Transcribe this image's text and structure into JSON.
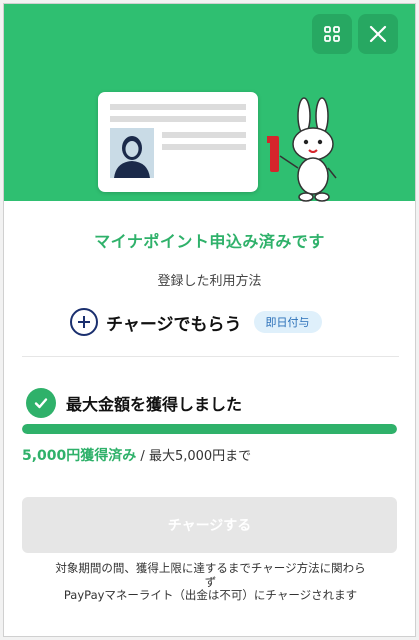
{
  "header": {
    "grid_icon": "grid-icon",
    "close_icon": "close-icon"
  },
  "status": {
    "headline": "マイナポイント申込み済みです",
    "subhead": "登録した利用方法"
  },
  "method": {
    "label": "チャージでもらう",
    "badge": "即日付与",
    "icon": "plus-circle-icon"
  },
  "achievement": {
    "label": "最大金額を獲得しました",
    "icon": "check-circle-icon",
    "progress": 1.0,
    "earned": "5,000円獲得済み",
    "separator": " / ",
    "max": "最大5,000円まで"
  },
  "charge_button": {
    "label": "チャージする"
  },
  "note": {
    "line1": "対象期間の間、獲得上限に達するまでチャージ方法に関わら",
    "line2": "ず",
    "line3": "PayPayマネーライト（出金は不可）にチャージされます"
  },
  "colors": {
    "brand_green": "#2fbf71",
    "accent_green": "#2fb16a",
    "badge_blue": "#2a6fb8"
  }
}
